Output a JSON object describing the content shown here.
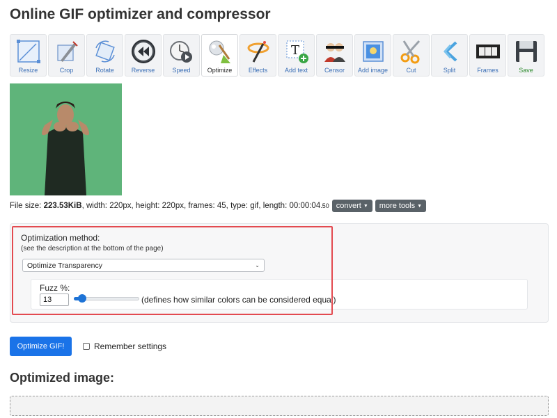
{
  "page": {
    "title": "Online GIF optimizer and compressor"
  },
  "toolbar": {
    "items": [
      {
        "label": "Resize",
        "icon": "resize-icon"
      },
      {
        "label": "Crop",
        "icon": "crop-icon"
      },
      {
        "label": "Rotate",
        "icon": "rotate-icon"
      },
      {
        "label": "Reverse",
        "icon": "reverse-icon"
      },
      {
        "label": "Speed",
        "icon": "speed-icon"
      },
      {
        "label": "Optimize",
        "icon": "optimize-icon",
        "active": true
      },
      {
        "label": "Effects",
        "icon": "effects-icon"
      },
      {
        "label": "Add text",
        "icon": "add-text-icon"
      },
      {
        "label": "Censor",
        "icon": "censor-icon"
      },
      {
        "label": "Add image",
        "icon": "add-image-icon"
      },
      {
        "label": "Cut",
        "icon": "cut-icon"
      },
      {
        "label": "Split",
        "icon": "split-icon"
      },
      {
        "label": "Frames",
        "icon": "frames-icon"
      },
      {
        "label": "Save",
        "icon": "save-icon"
      }
    ]
  },
  "fileinfo": {
    "size_label": "File size: ",
    "size_value": "223.53KiB",
    "details": ", width: 220px, height: 220px, frames: 45, type: gif, length: 00:00:04",
    "length_fraction": ".50",
    "convert_label": "convert",
    "more_tools_label": "more tools"
  },
  "options": {
    "method_label": "Optimization method:",
    "method_desc": "(see the description at the bottom of the page)",
    "method_selected": "Optimize Transparency",
    "fuzz_label": "Fuzz %:",
    "fuzz_value": "13",
    "fuzz_slider_fraction": 0.13,
    "fuzz_help": "(defines how similar colors can be considered equal)"
  },
  "actions": {
    "optimize_button": "Optimize GIF!",
    "remember_label": "Remember settings",
    "remember_checked": false
  },
  "result": {
    "title": "Optimized image:"
  },
  "colors": {
    "primary": "#1a73e8",
    "highlight": "#e34a50",
    "preview_bg": "#5fb47a"
  }
}
